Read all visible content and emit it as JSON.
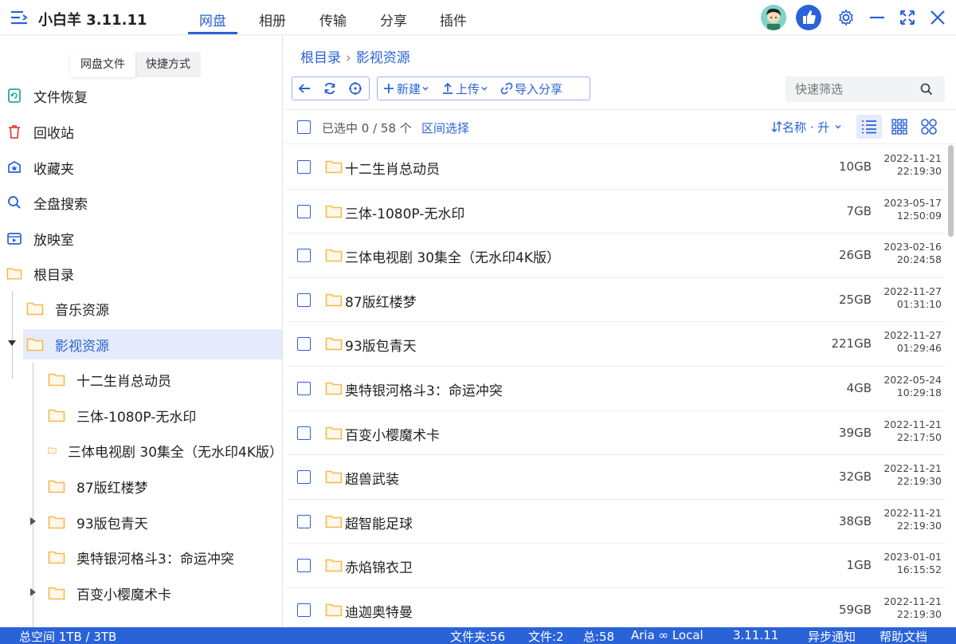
{
  "app": {
    "title": "小白羊 3.11.11"
  },
  "nav": {
    "tabs": [
      "网盘",
      "相册",
      "传输",
      "分享",
      "插件"
    ]
  },
  "sidebar": {
    "tabs": [
      "网盘文件",
      "快捷方式"
    ],
    "items": [
      {
        "label": "文件恢复",
        "icon": "file-restore-icon"
      },
      {
        "label": "回收站",
        "icon": "trash-icon"
      },
      {
        "label": "收藏夹",
        "icon": "favorites-icon"
      },
      {
        "label": "全盘搜索",
        "icon": "search-icon"
      },
      {
        "label": "放映室",
        "icon": "video-room-icon"
      },
      {
        "label": "根目录",
        "icon": "folder-icon"
      }
    ],
    "tree": [
      "音乐资源",
      "影视资源",
      "十二生肖总动员",
      "三体-1080P-无水印",
      "三体电视剧 30集全（无水印4K版）",
      "87版红楼梦",
      "93版包青天",
      "奥特银河格斗3：命运冲突",
      "百变小樱魔术卡"
    ]
  },
  "breadcrumb": {
    "root": "根目录",
    "separator": "›",
    "current": "影视资源"
  },
  "toolbar": {
    "new_label": "新建",
    "upload_label": "上传",
    "import_label": "导入分享"
  },
  "filter": {
    "placeholder": "快速筛选"
  },
  "list_header": {
    "selected": "已选中 0 / 58 个",
    "range_select": "区间选择",
    "sort_label": "名称 · 升"
  },
  "files": [
    {
      "name": "十二生肖总动员",
      "size": "10GB",
      "date": "2022-11-21",
      "time": "22:19:30"
    },
    {
      "name": "三体-1080P-无水印",
      "size": "7GB",
      "date": "2023-05-17",
      "time": "12:50:09"
    },
    {
      "name": "三体电视剧 30集全（无水印4K版）",
      "size": "26GB",
      "date": "2023-02-16",
      "time": "20:24:58"
    },
    {
      "name": "87版红楼梦",
      "size": "25GB",
      "date": "2022-11-27",
      "time": "01:31:10"
    },
    {
      "name": "93版包青天",
      "size": "221GB",
      "date": "2022-11-27",
      "time": "01:29:46"
    },
    {
      "name": "奥特银河格斗3：命运冲突",
      "size": "4GB",
      "date": "2022-05-24",
      "time": "10:29:18"
    },
    {
      "name": "百变小樱魔术卡",
      "size": "39GB",
      "date": "2022-11-21",
      "time": "22:17:50"
    },
    {
      "name": "超兽武装",
      "size": "32GB",
      "date": "2022-11-21",
      "time": "22:19:30"
    },
    {
      "name": "超智能足球",
      "size": "38GB",
      "date": "2022-11-21",
      "time": "22:19:30"
    },
    {
      "name": "赤焰锦衣卫",
      "size": "1GB",
      "date": "2023-01-01",
      "time": "16:15:52"
    },
    {
      "name": "迪迦奥特曼",
      "size": "59GB",
      "date": "2022-11-21",
      "time": "22:19:30"
    }
  ],
  "status": {
    "space": "总空间 1TB / 3TB",
    "folders": "文件夹:56",
    "files": "文件:2",
    "total": "总:58",
    "aria": "Aria ∞ Local",
    "version": "3.11.11",
    "notify": "异步通知",
    "help": "帮助文档"
  },
  "colors": {
    "accent": "#2a62d8",
    "folder": "#f5b94a",
    "selected_bg": "#e5ebfb",
    "statusbar": "#2a62d8"
  }
}
